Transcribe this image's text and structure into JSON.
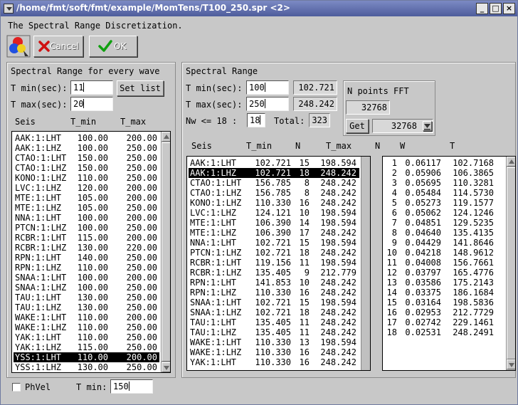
{
  "window": {
    "title": "/home/fmt/soft/fmt/example/MomTens/T100_250.spr <2>",
    "controls": [
      "_",
      "□",
      "×"
    ]
  },
  "toolbar": {
    "heading": "The Spectral Range Discretization.",
    "cancel_label": "Cancel",
    "ok_label": "OK"
  },
  "left": {
    "title": "Spectral Range for every wave",
    "tmin_label": "T min(sec):",
    "tmin_value": "11",
    "set_list_label": "Set list",
    "tmax_label": "T max(sec):",
    "tmax_value": "20",
    "col_seis": "Seis",
    "col_tmin": "T_min",
    "col_tmax": "T_max",
    "rows": [
      [
        "AAK:1:LHT",
        "100.00",
        "200.00"
      ],
      [
        "AAK:1:LHZ",
        "100.00",
        "250.00"
      ],
      [
        "CTAO:1:LHT",
        "150.00",
        "250.00"
      ],
      [
        "CTAO:1:LHZ",
        "150.00",
        "250.00"
      ],
      [
        "KONO:1:LHZ",
        "110.00",
        "250.00"
      ],
      [
        "LVC:1:LHZ",
        "120.00",
        "200.00"
      ],
      [
        "MTE:1:LHT",
        "105.00",
        "200.00"
      ],
      [
        "MTE:1:LHZ",
        "105.00",
        "250.00"
      ],
      [
        "NNA:1:LHT",
        "100.00",
        "200.00"
      ],
      [
        "PTCN:1:LHZ",
        "100.00",
        "250.00"
      ],
      [
        "RCBR:1:LHT",
        "115.00",
        "200.00"
      ],
      [
        "RCBR:1:LHZ",
        "130.00",
        "220.00"
      ],
      [
        "RPN:1:LHT",
        "140.00",
        "250.00"
      ],
      [
        "RPN:1:LHZ",
        "110.00",
        "250.00"
      ],
      [
        "SNAA:1:LHT",
        "100.00",
        "200.00"
      ],
      [
        "SNAA:1:LHZ",
        "100.00",
        "250.00"
      ],
      [
        "TAU:1:LHT",
        "130.00",
        "250.00"
      ],
      [
        "TAU:1:LHZ",
        "130.00",
        "250.00"
      ],
      [
        "WAKE:1:LHT",
        "110.00",
        "200.00"
      ],
      [
        "WAKE:1:LHZ",
        "110.00",
        "250.00"
      ],
      [
        "YAK:1:LHT",
        "110.00",
        "250.00"
      ],
      [
        "YAK:1:LHZ",
        "115.00",
        "250.00"
      ],
      [
        "YSS:1:LHT",
        "110.00",
        "200.00"
      ],
      [
        "YSS:1:LHZ",
        "130.00",
        "250.00"
      ]
    ],
    "selected_index": 22,
    "phvel_label": "PhVel",
    "bottom_tmin_label": "T min:",
    "bottom_tmin_value": "150"
  },
  "right": {
    "title": "Spectral Range",
    "tmin_label": "T min(sec):",
    "tmin_value": "100",
    "tmin_readout": "102.721",
    "tmax_label": "T max(sec):",
    "tmax_value": "250",
    "tmax_readout": "248.242",
    "nw_label": "Nw  <= 18 :",
    "nw_value": "18",
    "total_label": "Total:",
    "total_value": "323",
    "fft_title": "N points FFT",
    "fft_value": "32768",
    "get_label": "Get",
    "fft_select": "32768",
    "col_seis": "Seis",
    "col_tmin": "T_min",
    "col_n": "N",
    "col_tmax": "T_max",
    "col_n2": "N",
    "col_w": "W",
    "col_t": "T",
    "rows": [
      [
        "AAK:1:LHT",
        "102.721",
        "15",
        "198.594"
      ],
      [
        "AAK:1:LHZ",
        "102.721",
        "18",
        "248.242"
      ],
      [
        "CTAO:1:LHT",
        "156.785",
        "8",
        "248.242"
      ],
      [
        "CTAO:1:LHZ",
        "156.785",
        "8",
        "248.242"
      ],
      [
        "KONO:1:LHZ",
        "110.330",
        "16",
        "248.242"
      ],
      [
        "LVC:1:LHZ",
        "124.121",
        "10",
        "198.594"
      ],
      [
        "MTE:1:LHT",
        "106.390",
        "14",
        "198.594"
      ],
      [
        "MTE:1:LHZ",
        "106.390",
        "17",
        "248.242"
      ],
      [
        "NNA:1:LHT",
        "102.721",
        "15",
        "198.594"
      ],
      [
        "PTCN:1:LHZ",
        "102.721",
        "18",
        "248.242"
      ],
      [
        "RCBR:1:LHT",
        "119.156",
        "11",
        "198.594"
      ],
      [
        "RCBR:1:LHZ",
        "135.405",
        "9",
        "212.779"
      ],
      [
        "RPN:1:LHT",
        "141.853",
        "10",
        "248.242"
      ],
      [
        "RPN:1:LHZ",
        "110.330",
        "16",
        "248.242"
      ],
      [
        "SNAA:1:LHT",
        "102.721",
        "15",
        "198.594"
      ],
      [
        "SNAA:1:LHZ",
        "102.721",
        "18",
        "248.242"
      ],
      [
        "TAU:1:LHT",
        "135.405",
        "11",
        "248.242"
      ],
      [
        "TAU:1:LHZ",
        "135.405",
        "11",
        "248.242"
      ],
      [
        "WAKE:1:LHT",
        "110.330",
        "13",
        "198.594"
      ],
      [
        "WAKE:1:LHZ",
        "110.330",
        "16",
        "248.242"
      ],
      [
        "YAK:1:LHT",
        "110.330",
        "16",
        "248.242"
      ]
    ],
    "selected_index": 1,
    "freq_rows": [
      [
        "1",
        "0.06117",
        "102.7168"
      ],
      [
        "2",
        "0.05906",
        "106.3865"
      ],
      [
        "3",
        "0.05695",
        "110.3281"
      ],
      [
        "4",
        "0.05484",
        "114.5730"
      ],
      [
        "5",
        "0.05273",
        "119.1577"
      ],
      [
        "6",
        "0.05062",
        "124.1246"
      ],
      [
        "7",
        "0.04851",
        "129.5235"
      ],
      [
        "8",
        "0.04640",
        "135.4135"
      ],
      [
        "9",
        "0.04429",
        "141.8646"
      ],
      [
        "10",
        "0.04218",
        "148.9612"
      ],
      [
        "11",
        "0.04008",
        "156.7661"
      ],
      [
        "12",
        "0.03797",
        "165.4776"
      ],
      [
        "13",
        "0.03586",
        "175.2143"
      ],
      [
        "14",
        "0.03375",
        "186.1684"
      ],
      [
        "15",
        "0.03164",
        "198.5836"
      ],
      [
        "16",
        "0.02953",
        "212.7729"
      ],
      [
        "17",
        "0.02742",
        "229.1461"
      ],
      [
        "18",
        "0.02531",
        "248.2491"
      ]
    ]
  }
}
